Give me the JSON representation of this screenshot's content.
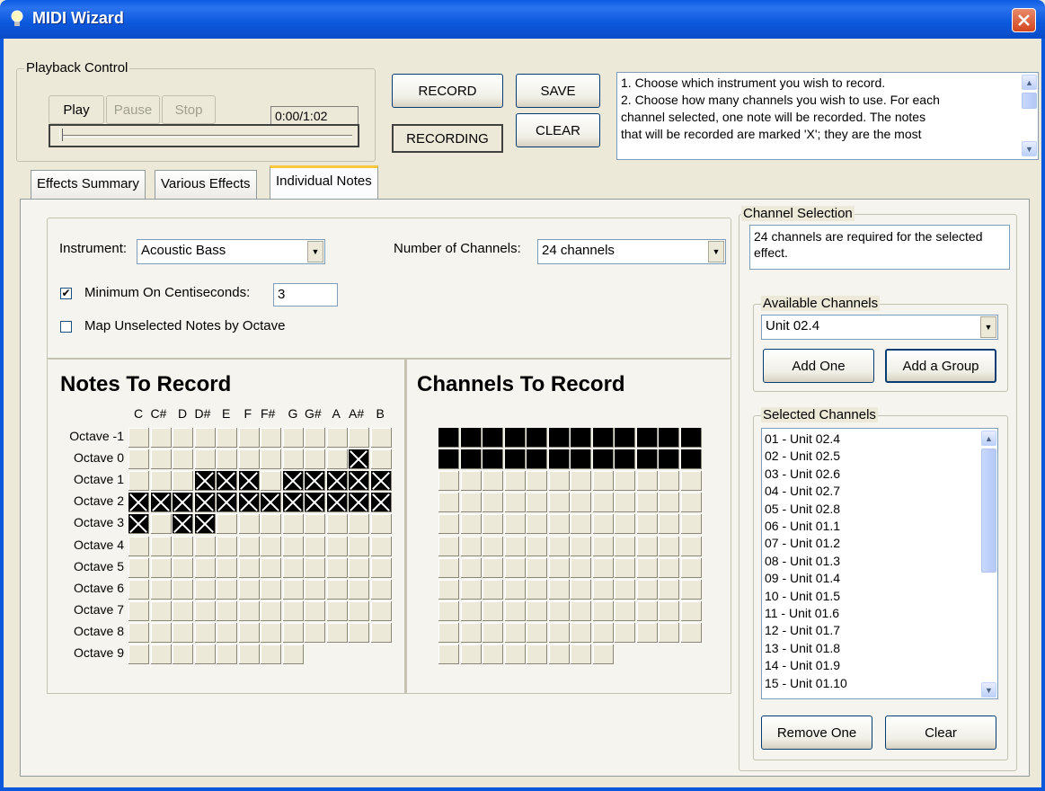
{
  "window": {
    "title": "MIDI Wizard"
  },
  "playback": {
    "group_label": "Playback Control",
    "play": "Play",
    "pause": "Pause",
    "stop": "Stop",
    "time": "0:00/1:02",
    "progress": 0
  },
  "toolbar": {
    "record": "RECORD",
    "save": "SAVE",
    "recording": "RECORDING",
    "clear": "CLEAR"
  },
  "instructions": [
    "1. Choose which instrument you wish to record.",
    "2. Choose how many channels you wish to use.  For each",
    "channel selected, one note will be recorded.  The notes",
    "that will be recorded are marked 'X'; they are the most"
  ],
  "tabs": [
    "Effects Summary",
    "Various Effects",
    "Individual Notes"
  ],
  "options": {
    "instrument_label": "Instrument:",
    "instrument_value": "Acoustic Bass",
    "channels_label": "Number of Channels:",
    "channels_value": "24 channels",
    "min_on_label": "Minimum On Centiseconds:",
    "min_on_value": "3",
    "min_on_checked": true,
    "map_unselected_label": "Map Unselected Notes by Octave",
    "map_unselected_checked": false
  },
  "notes_panel": {
    "title": "Notes To Record",
    "note_names": [
      "C",
      "C#",
      "D",
      "D#",
      "E",
      "F",
      "F#",
      "G",
      "G#",
      "A",
      "A#",
      "B"
    ],
    "octaves": [
      "Octave -1",
      "Octave 0",
      "Octave 1",
      "Octave 2",
      "Octave 3",
      "Octave 4",
      "Octave 5",
      "Octave 6",
      "Octave 7",
      "Octave 8",
      "Octave 9"
    ],
    "selected": [
      [
        1,
        10
      ],
      [
        2,
        3
      ],
      [
        2,
        4
      ],
      [
        2,
        5
      ],
      [
        2,
        7
      ],
      [
        2,
        8
      ],
      [
        2,
        9
      ],
      [
        2,
        10
      ],
      [
        2,
        11
      ],
      [
        3,
        0
      ],
      [
        3,
        1
      ],
      [
        3,
        2
      ],
      [
        3,
        3
      ],
      [
        3,
        4
      ],
      [
        3,
        5
      ],
      [
        3,
        6
      ],
      [
        3,
        7
      ],
      [
        3,
        8
      ],
      [
        3,
        9
      ],
      [
        3,
        10
      ],
      [
        3,
        11
      ],
      [
        4,
        0
      ],
      [
        4,
        2
      ],
      [
        4,
        3
      ]
    ]
  },
  "channels_panel": {
    "title": "Channels To Record",
    "filled_count": 24
  },
  "channel_selection": {
    "group_label": "Channel Selection",
    "message": "24 channels are required for the selected effect.",
    "available_label": "Available Channels",
    "available_value": "Unit 02.4",
    "add_one": "Add One",
    "add_group": "Add a Group",
    "selected_label": "Selected Channels",
    "selected_items": [
      "01 - Unit 02.4",
      "02 - Unit 02.5",
      "03 - Unit 02.6",
      "04 - Unit 02.7",
      "05 - Unit 02.8",
      "06 - Unit 01.1",
      "07 - Unit 01.2",
      "08 - Unit 01.3",
      "09 - Unit 01.4",
      "10 - Unit 01.5",
      "11 - Unit 01.6",
      "12 - Unit 01.7",
      "13 - Unit 01.8",
      "14 - Unit 01.9",
      "15 - Unit 01.10"
    ],
    "remove_one": "Remove One",
    "clear": "Clear"
  }
}
